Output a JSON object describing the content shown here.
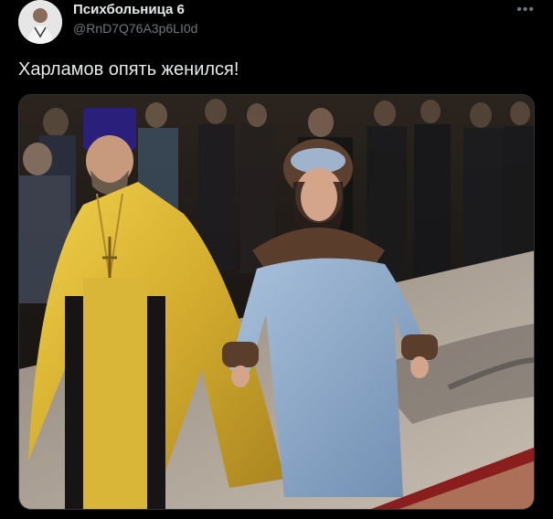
{
  "tweet": {
    "display_name": "Психбольница 6",
    "handle": "@RnD7Q76A3p6LI0d",
    "text": "Харламов опять женился!",
    "more_icon": "ellipsis-icon",
    "more_glyph": "•••"
  },
  "media": {
    "kind": "photo",
    "colors": {
      "background": "#1a1612",
      "floor": "#b9aea3",
      "robe_gold": "#d9b637",
      "dress_blue": "#8ea9c8",
      "fur": "#5a3e2b",
      "hat_purple": "#2a1f7a",
      "carpet_red": "#8a1e1e"
    }
  }
}
